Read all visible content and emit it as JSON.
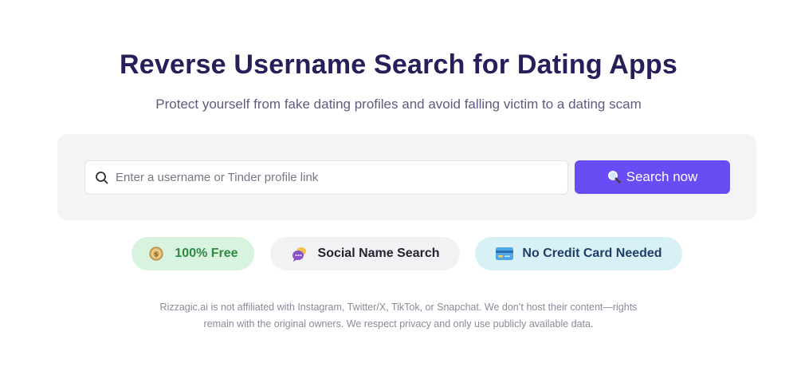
{
  "hero": {
    "title": "Reverse Username Search for Dating Apps",
    "subtitle": "Protect yourself from fake dating profiles and avoid falling victim to a dating scam"
  },
  "search": {
    "placeholder": "Enter a username or Tinder profile link",
    "value": "",
    "button_label": "Search now",
    "input_icon": "search-icon",
    "button_icon": "magnifier-emoji-icon",
    "button_color": "#6a4cf5"
  },
  "features": [
    {
      "label": "100% Free",
      "icon": "coin-icon",
      "bg": "#d8f3e0",
      "color": "#2d8a3e"
    },
    {
      "label": "Social Name Search",
      "icon": "chat-bubbles-icon",
      "bg": "#f2f2f4",
      "color": "#222230"
    },
    {
      "label": "No Credit Card Needed",
      "icon": "credit-card-icon",
      "bg": "#d8f1f7",
      "color": "#1f3f66"
    }
  ],
  "disclaimer": {
    "line1": "Rizzagic.ai is not affiliated with Instagram, Twitter/X, TikTok, or Snapchat. We don’t host their content—rights",
    "line2": "remain with the original owners. We respect privacy and only use publicly available data."
  }
}
